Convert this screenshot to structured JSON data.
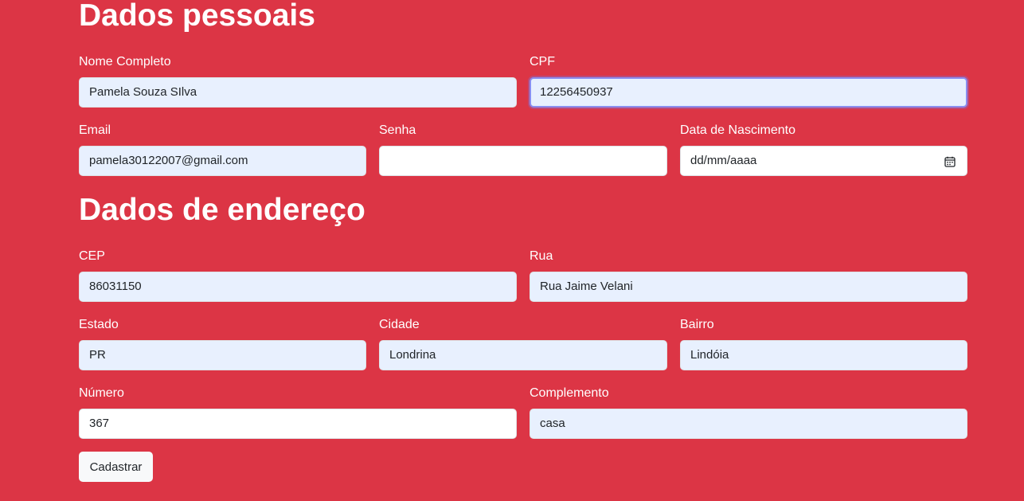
{
  "personal": {
    "heading": "Dados pessoais",
    "nome": {
      "label": "Nome Completo",
      "value": "Pamela Souza SIlva"
    },
    "cpf": {
      "label": "CPF",
      "value": "12256450937"
    },
    "email": {
      "label": "Email",
      "value": "pamela30122007@gmail.com"
    },
    "senha": {
      "label": "Senha",
      "value": ""
    },
    "nascimento": {
      "label": "Data de Nascimento",
      "value": "dd/mm/aaaa",
      "icon": "calendar-icon"
    }
  },
  "address": {
    "heading": "Dados de endereço",
    "cep": {
      "label": "CEP",
      "value": "86031150"
    },
    "rua": {
      "label": "Rua",
      "value": "Rua Jaime Velani"
    },
    "estado": {
      "label": "Estado",
      "value": "PR"
    },
    "cidade": {
      "label": "Cidade",
      "value": "Londrina"
    },
    "bairro": {
      "label": "Bairro",
      "value": "Lindóia"
    },
    "numero": {
      "label": "Número",
      "value": "367"
    },
    "complemento": {
      "label": "Complemento",
      "value": "casa"
    }
  },
  "submit_label": "Cadastrar",
  "colors": {
    "background": "#dc3545",
    "autofill": "#e8f0fe",
    "input_white": "#ffffff",
    "button": "#f8f9fa",
    "focus_ring": "#8a8ef0"
  }
}
